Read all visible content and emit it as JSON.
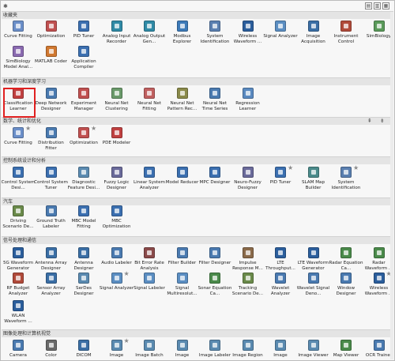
{
  "title_bar": {
    "pin_glyph": "✱",
    "buttons": [
      "▤",
      "▥",
      "▦"
    ]
  },
  "colors": {
    "highlight": "#e02020",
    "header_bg": "#e4e4e4",
    "background": "#f7f7f7"
  },
  "sections": [
    {
      "title": "收藏夹",
      "rows": [
        [
          {
            "label": "Curve Fitting",
            "color": "#6b8fc9",
            "star": false
          },
          {
            "label": "Optimization",
            "color": "#c05050",
            "star": false
          },
          {
            "label": "PID Tuner",
            "color": "#3b6fb0",
            "star": false
          },
          {
            "label": "Analog Input Recorder",
            "color": "#2f8aa6",
            "star": false
          },
          {
            "label": "Analog Output Gen...",
            "color": "#2f8aa6",
            "star": false
          },
          {
            "label": "Modbus Explorer",
            "color": "#3d7ab8",
            "star": false
          },
          {
            "label": "System Identification",
            "color": "#5a7fb0",
            "star": false
          },
          {
            "label": "Wireless Waveform ...",
            "color": "#2b5e9c",
            "star": false
          },
          {
            "label": "Signal Analyzer",
            "color": "#5b8ec2",
            "star": false
          },
          {
            "label": "Image Acquisition",
            "color": "#3a6ea5",
            "star": false
          },
          {
            "label": "Instrument Control",
            "color": "#b04a3a",
            "star": false
          },
          {
            "label": "SimBiology",
            "color": "#5a9a5a",
            "star": false
          }
        ],
        [
          {
            "label": "SimBiology Model Anal...",
            "color": "#8a6ab0",
            "star": false
          },
          {
            "label": "MATLAB Coder",
            "color": "#d07830",
            "star": false
          },
          {
            "label": "Application Compiler",
            "color": "#3b6fb0",
            "star": false
          }
        ]
      ]
    },
    {
      "title": "机器学习和深度学习",
      "rows": [
        [
          {
            "label": "Classification Learner",
            "color": "#c04040",
            "star": false
          },
          {
            "label": "Deep Network Designer",
            "color": "#4a7ab0",
            "star": false
          },
          {
            "label": "Experiment Manager",
            "color": "#c05050",
            "star": false
          },
          {
            "label": "Neural Net Clustering",
            "color": "#6a9a6a",
            "star": false
          },
          {
            "label": "Neural Net Fitting",
            "color": "#c06060",
            "star": false
          },
          {
            "label": "Neural Net Pattern Rec...",
            "color": "#8a8a4a",
            "star": false
          },
          {
            "label": "Neural Net Time Series",
            "color": "#4a7ab0",
            "star": false
          },
          {
            "label": "Regression Learner",
            "color": "#5a8ac0",
            "star": false
          }
        ]
      ]
    },
    {
      "title": "数学、统计和优化",
      "rows": [
        [
          {
            "label": "Curve Fitting",
            "color": "#6b8fc9",
            "star": true
          },
          {
            "label": "Distribution Fitter",
            "color": "#4a7ab0",
            "star": false
          },
          {
            "label": "Optimization",
            "color": "#c05050",
            "star": true
          },
          {
            "label": "PDE Modeler",
            "color": "#c04040",
            "star": false
          }
        ]
      ]
    },
    {
      "title": "控制系统设计和分析",
      "rows": [
        [
          {
            "label": "Control System Desi...",
            "color": "#3b6fb0",
            "star": false
          },
          {
            "label": "Control System Tuner",
            "color": "#3b6fb0",
            "star": false
          },
          {
            "label": "Diagnostic Feature Desi...",
            "color": "#5a8ab0",
            "star": false
          },
          {
            "label": "Fuzzy Logic Designer",
            "color": "#6a6a9a",
            "star": false
          },
          {
            "label": "Linear System Analyzer",
            "color": "#3b6fb0",
            "star": false
          },
          {
            "label": "Model Reducer",
            "color": "#3b6fb0",
            "star": false
          },
          {
            "label": "MPC Designer",
            "color": "#3b6fb0",
            "star": false
          },
          {
            "label": "Neuro-Fuzzy Designer",
            "color": "#6a6a9a",
            "star": false
          },
          {
            "label": "PID Tuner",
            "color": "#3b6fb0",
            "star": true
          },
          {
            "label": "SLAM Map Builder",
            "color": "#4a8a8a",
            "star": false
          },
          {
            "label": "System Identification",
            "color": "#5a7fb0",
            "star": true
          }
        ]
      ]
    },
    {
      "title": "汽车",
      "rows": [
        [
          {
            "label": "Driving Scenario De...",
            "color": "#6a8a4a",
            "star": false
          },
          {
            "label": "Ground Truth Labeler",
            "color": "#4a7ab0",
            "star": false
          },
          {
            "label": "MBC Model Fitting",
            "color": "#3b6fb0",
            "star": false
          },
          {
            "label": "MBC Optimization",
            "color": "#3b6fb0",
            "star": false
          }
        ]
      ]
    },
    {
      "title": "信号处理和通信",
      "rows": [
        [
          {
            "label": "5G Waveform Generator",
            "color": "#2b5e9c",
            "star": false
          },
          {
            "label": "Antenna Array Designer",
            "color": "#3a6ea5",
            "star": false
          },
          {
            "label": "Antenna Designer",
            "color": "#3a6ea5",
            "star": false
          },
          {
            "label": "Audio Labeler",
            "color": "#4a7ab0",
            "star": false
          },
          {
            "label": "Bit Error Rate Analysis",
            "color": "#8a4a4a",
            "star": false
          },
          {
            "label": "Filter Builder",
            "color": "#4a7ab0",
            "star": false
          },
          {
            "label": "Filter Designer",
            "color": "#4a7ab0",
            "star": false
          },
          {
            "label": "Impulse Response M...",
            "color": "#8a6a4a",
            "star": false
          },
          {
            "label": "LTE Throughput...",
            "color": "#2b5e9c",
            "star": false
          },
          {
            "label": "LTE Waveform Generator",
            "color": "#2b5e9c",
            "star": false
          },
          {
            "label": "Radar Equation Ca...",
            "color": "#4a8a4a",
            "star": false
          },
          {
            "label": "Radar Waveform ...",
            "color": "#4a8a4a",
            "star": false
          }
        ],
        [
          {
            "label": "RF Budget Analyzer",
            "color": "#b04a3a",
            "star": false
          },
          {
            "label": "Sensor Array Analyzer",
            "color": "#3a6ea5",
            "star": false
          },
          {
            "label": "SerDes Designer",
            "color": "#5a8ab0",
            "star": false
          },
          {
            "label": "Signal Analyzer",
            "color": "#5b8ec2",
            "star": true
          },
          {
            "label": "Signal Labeler",
            "color": "#5b8ec2",
            "star": false
          },
          {
            "label": "Signal Multiresolut...",
            "color": "#5b8ec2",
            "star": false
          },
          {
            "label": "Sonar Equation Ca...",
            "color": "#4a8a4a",
            "star": false
          },
          {
            "label": "Tracking Scenario De...",
            "color": "#6a8a4a",
            "star": false
          },
          {
            "label": "Wavelet Analyzer",
            "color": "#4a7ab0",
            "star": false
          },
          {
            "label": "Wavelet Signal Deno...",
            "color": "#4a7ab0",
            "star": false
          },
          {
            "label": "Window Designer",
            "color": "#4a7ab0",
            "star": false
          },
          {
            "label": "Wireless Waveform ...",
            "color": "#2b5e9c",
            "star": true
          }
        ],
        [
          {
            "label": "WLAN Waveform ...",
            "color": "#2b5e9c",
            "star": false
          }
        ]
      ]
    },
    {
      "title": "图像处理和计算机视觉",
      "rows": [
        [
          {
            "label": "Camera",
            "color": "#4a7ab0",
            "star": false
          },
          {
            "label": "Color",
            "color": "#6a6a6a",
            "star": false
          },
          {
            "label": "DICOM",
            "color": "#3a6ea5",
            "star": false
          },
          {
            "label": "Image",
            "color": "#5a8ab0",
            "star": true
          },
          {
            "label": "Image Batch",
            "color": "#5a8ab0",
            "star": false
          },
          {
            "label": "Image",
            "color": "#5a8ab0",
            "star": false
          },
          {
            "label": "Image Labeler",
            "color": "#5a8ab0",
            "star": false
          },
          {
            "label": "Image Region",
            "color": "#5a8ab0",
            "star": false
          },
          {
            "label": "Image",
            "color": "#5a8ab0",
            "star": false
          },
          {
            "label": "Image Viewer",
            "color": "#5a8ab0",
            "star": false
          },
          {
            "label": "Map Viewer",
            "color": "#4a8a4a",
            "star": false
          },
          {
            "label": "OCR Trainer",
            "color": "#4a7ab0",
            "star": false
          }
        ]
      ]
    }
  ],
  "section_controls": {
    "collapse_glyph": "⇞",
    "expand_glyph": "⇟"
  }
}
